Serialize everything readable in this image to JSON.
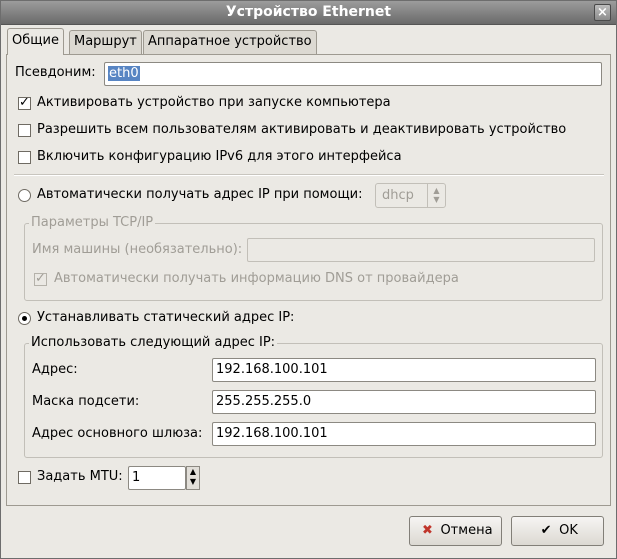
{
  "window": {
    "title": "Устройство Ethernet",
    "close_glyph": "×"
  },
  "tabs": [
    {
      "label": "Общие",
      "active": true
    },
    {
      "label": "Маршрут",
      "active": false
    },
    {
      "label": "Аппаратное устройство",
      "active": false
    }
  ],
  "nickname": {
    "label": "Псевдоним:",
    "value": "eth0"
  },
  "options": {
    "activate_on_boot": {
      "label": "Активировать устройство при запуске компьютера",
      "checked": true
    },
    "allow_all_users": {
      "label": "Разрешить всем пользователям активировать и деактивировать устройство",
      "checked": false
    },
    "enable_ipv6": {
      "label": "Включить конфигурацию IPv6 для этого интерфейса",
      "checked": false
    }
  },
  "auto_ip": {
    "label": "Автоматически получать адрес IP при помощи:",
    "selected": false,
    "method": "dhcp"
  },
  "tcp_group": {
    "title": "Параметры TCP/IP",
    "hostname_label": "Имя машины (необязательно):",
    "hostname_value": "",
    "dns_label": "Автоматически получать информацию DNS от провайдера",
    "dns_checked": true
  },
  "static_ip": {
    "label": "Устанавливать статический адрес IP:",
    "selected": true
  },
  "static_group": {
    "title": "Использовать следующий адрес IP:",
    "address_label": "Адрес:",
    "address_value": "192.168.100.101",
    "mask_label": "Маска подсети:",
    "mask_value": "255.255.255.0",
    "gateway_label": "Адрес основного шлюза:",
    "gateway_value": "192.168.100.101"
  },
  "mtu": {
    "label": "Задать MTU:",
    "checked": false,
    "value": "1"
  },
  "buttons": {
    "cancel_label": "Отмена",
    "ok_label": "OK"
  },
  "colors": {
    "window_bg": "#ebe9e4",
    "selection": "#5885c3",
    "titlebar": "#7d7d7d",
    "cancel_icon": "#c0352b"
  }
}
